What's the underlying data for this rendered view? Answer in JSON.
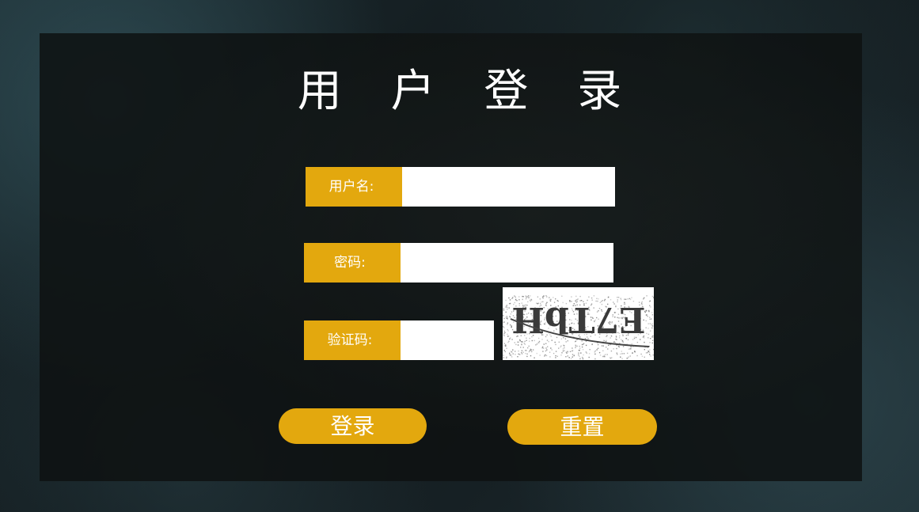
{
  "title": "用 户 登 录",
  "form": {
    "username": {
      "label": "用户名:",
      "value": "",
      "placeholder": ""
    },
    "password": {
      "label": "密码:",
      "value": "",
      "placeholder": ""
    },
    "captcha": {
      "label": "验证码:",
      "value": "",
      "placeholder": "",
      "image_text": "E7TbH"
    }
  },
  "buttons": {
    "login": "登录",
    "reset": "重置"
  },
  "colors": {
    "accent": "#e3a80e",
    "panel": "#0e1212",
    "text": "#ffffff"
  }
}
